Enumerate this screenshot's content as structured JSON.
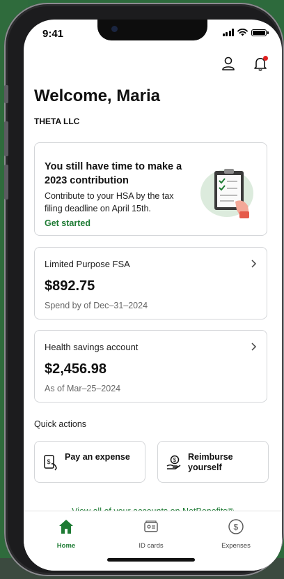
{
  "status_bar": {
    "time": "9:41"
  },
  "greeting": "Welcome, Maria",
  "employer": "THETA LLC",
  "promo": {
    "title": "You still have time to make a 2023 contribution",
    "description": "Contribute to your HSA by the tax filing deadline on April 15th.",
    "cta": "Get started"
  },
  "accounts": [
    {
      "name": "Limited Purpose FSA",
      "amount": "$892.75",
      "subtext": "Spend by of Dec–31–2024"
    },
    {
      "name": "Health savings account",
      "amount": "$2,456.98",
      "subtext": "As of Mar–25–2024"
    }
  ],
  "quick_actions": {
    "title": "Quick actions",
    "items": [
      {
        "label": "Pay an expense",
        "icon": "pay-expense-icon"
      },
      {
        "label": "Reimburse yourself",
        "icon": "reimburse-icon"
      }
    ]
  },
  "view_all_link": "View all of your accounts on NetBenefits®",
  "tab_bar": {
    "tabs": [
      {
        "label": "Home",
        "icon": "home-icon",
        "active": true
      },
      {
        "label": "ID cards",
        "icon": "id-card-icon",
        "active": false
      },
      {
        "label": "Expenses",
        "icon": "dollar-circle-icon",
        "active": false
      }
    ]
  },
  "colors": {
    "brand_green": "#1e7b34",
    "alert_red": "#e02020",
    "background_green": "#2d6a3c"
  }
}
